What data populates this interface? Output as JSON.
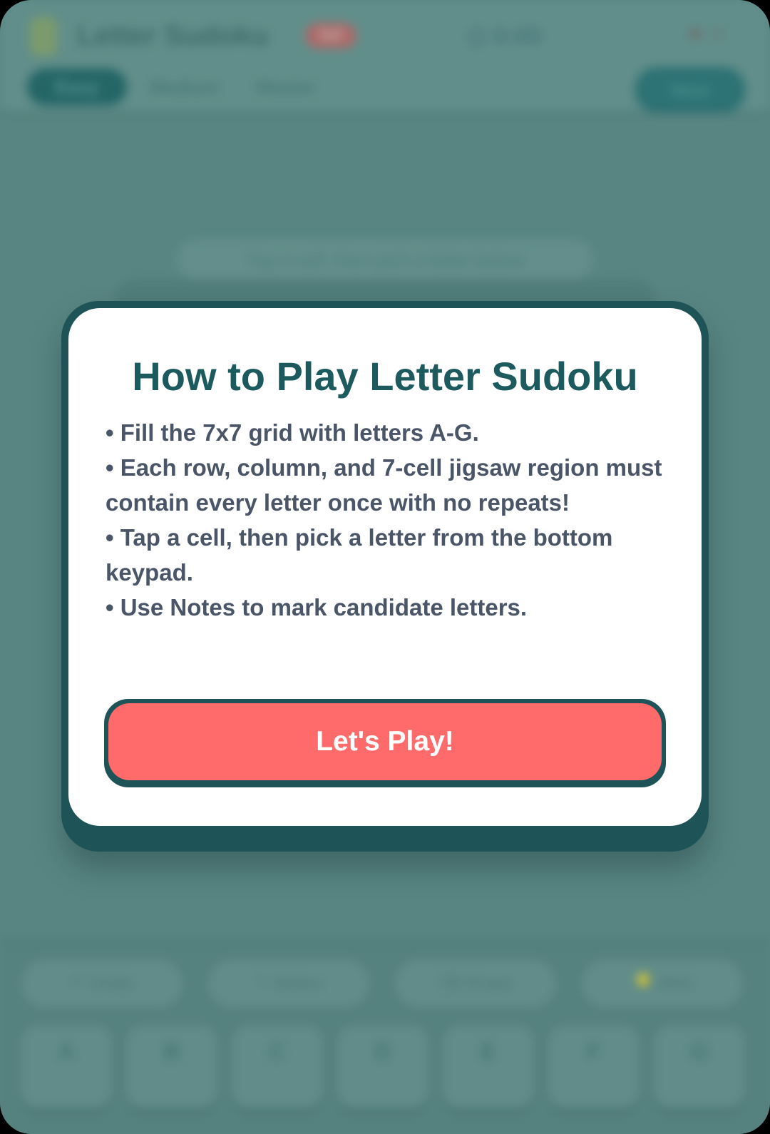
{
  "header": {
    "app_title": "Letter Sudoku",
    "badge": "7x7",
    "timer": "0:00",
    "actions": "⚑ ?"
  },
  "tabs": [
    {
      "label": "Easy"
    },
    {
      "label": "Medium"
    },
    {
      "label": "Master"
    }
  ],
  "new_game_label": "New",
  "hint_text": "Tap a cell, then pick a letter below",
  "tools": [
    {
      "label": "↶ Undo"
    },
    {
      "label": "✎ Notes"
    },
    {
      "label": "⌫ Erase"
    },
    {
      "label": "💡 Hint"
    }
  ],
  "keypad": [
    "A",
    "B",
    "C",
    "D",
    "E",
    "F",
    "G"
  ],
  "modal": {
    "title": "How to Play Letter Sudoku",
    "rules": [
      "• Fill the 7x7 grid with letters A-G.",
      "• Each row, column, and 7-cell jigsaw region must contain every letter once with no repeats!",
      "• Tap a cell, then pick a letter from the bottom keypad.",
      "• Use Notes to mark candidate letters."
    ],
    "button_label": "Let's Play!"
  },
  "colors": {
    "accent": "#1d5a5e",
    "button": "#ff6b6b",
    "text": "#4a5568"
  }
}
